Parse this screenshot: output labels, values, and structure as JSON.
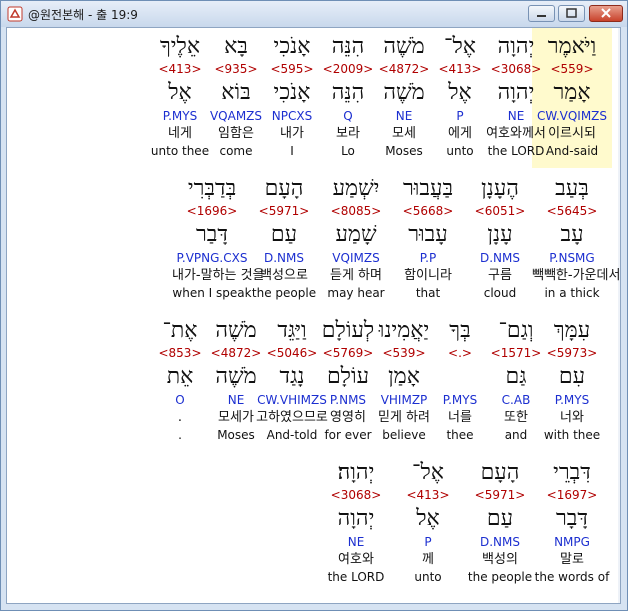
{
  "window": {
    "title": "@원전본해 - 출 19:9"
  },
  "verse": {
    "rows": [
      [
        {
          "heb1": "וַיֹּאמֶר",
          "strong": "<559>",
          "heb2": "אָמַר",
          "morph": "CW.VQIMZS",
          "kor": "이르시되",
          "eng": "And-said",
          "selected": true
        },
        {
          "heb1": "יְהוָה",
          "strong": "<3068>",
          "heb2": "יְהוָה",
          "morph": "NE",
          "kor": "여호와께서",
          "eng": "the LORD"
        },
        {
          "heb1": "אֶל־",
          "strong": "<413>",
          "heb2": "אֶל",
          "morph": "P",
          "kor": "에게",
          "eng": "unto"
        },
        {
          "heb1": "מֹשֶׁה",
          "strong": "<4872>",
          "heb2": "מֹשֶׁה",
          "morph": "NE",
          "kor": "모세",
          "eng": "Moses"
        },
        {
          "heb1": "הִנֵּה",
          "strong": "<2009>",
          "heb2": "הִנֵּה",
          "morph": "Q",
          "kor": "보라",
          "eng": "Lo"
        },
        {
          "heb1": "אָנֹכִי",
          "strong": "<595>",
          "heb2": "אָנֹכִי",
          "morph": "NPCXS",
          "kor": "내가",
          "eng": "I"
        },
        {
          "heb1": "בָּא",
          "strong": "<935>",
          "heb2": "בּוֹא",
          "morph": "VQAMZS",
          "kor": "임함은",
          "eng": "come"
        },
        {
          "heb1": "אֵלֶיךָ",
          "strong": "<413>",
          "heb2": "אֶל",
          "morph": "P.MYS",
          "kor": "네게",
          "eng": "unto thee"
        }
      ],
      [
        {
          "heb1": "בְּעַב",
          "strong": "<5645>",
          "heb2": "עָב",
          "morph": "P.NSMG",
          "kor": "빽빽한-가운데서",
          "eng": "in a thick"
        },
        {
          "heb1": "הֶעָנָן",
          "strong": "<6051>",
          "heb2": "עָנָן",
          "morph": "D.NMS",
          "kor": "구름",
          "eng": "cloud"
        },
        {
          "heb1": "בַּעֲבוּר",
          "strong": "<5668>",
          "heb2": "עָבוּר",
          "morph": "P.P",
          "kor": "함이니라",
          "eng": "that"
        },
        {
          "heb1": "יִשְׁמַע",
          "strong": "<8085>",
          "heb2": "שָׁמַע",
          "morph": "VQIMZS",
          "kor": "듣게 하며",
          "eng": "may hear"
        },
        {
          "heb1": "הָעָם",
          "strong": "<5971>",
          "heb2": "עַם",
          "morph": "D.NMS",
          "kor": "백성으로",
          "eng": "the people"
        },
        {
          "heb1": "בְּדַבְּרִי",
          "strong": "<1696>",
          "heb2": "דָּבַר",
          "morph": "P.VPNG.CXS",
          "kor": "내가-말하는 것을",
          "eng": "when I speak"
        }
      ],
      [
        {
          "heb1": "עִמָּךְ",
          "strong": "<5973>",
          "heb2": "עִם",
          "morph": "P.MYS",
          "kor": "너와",
          "eng": "with thee"
        },
        {
          "heb1": "וְגַם־",
          "strong": "<1571>",
          "heb2": "גַּם",
          "morph": "C.AB",
          "kor": "또한",
          "eng": "and"
        },
        {
          "heb1": "בְּךָ",
          "strong": "<.>",
          "heb2": "",
          "morph": "P.MYS",
          "kor": "너를",
          "eng": "thee"
        },
        {
          "heb1": "יַאֲמִינוּ",
          "strong": "<539>",
          "heb2": "אָמַן",
          "morph": "VHIMZP",
          "kor": "믿게 하려",
          "eng": "believe"
        },
        {
          "heb1": "לְעוֹלָם",
          "strong": "<5769>",
          "heb2": "עוֹלָם",
          "morph": "P.NMS",
          "kor": "영영히",
          "eng": "for ever"
        },
        {
          "heb1": "וַיַּגֵּד",
          "strong": "<5046>",
          "heb2": "נָגַד",
          "morph": "CW.VHIMZS",
          "kor": "고하였으므로",
          "eng": "And-told"
        },
        {
          "heb1": "מֹשֶׁה",
          "strong": "<4872>",
          "heb2": "מֹשֶׁה",
          "morph": "NE",
          "kor": "모세가",
          "eng": "Moses"
        },
        {
          "heb1": "אֶת־",
          "strong": "<853>",
          "heb2": "אֵת",
          "morph": "O",
          "kor": ".",
          "eng": "."
        }
      ],
      [
        {
          "heb1": "דִּבְרֵי",
          "strong": "<1697>",
          "heb2": "דָּבָר",
          "morph": "NMPG",
          "kor": "말로",
          "eng": "the words of"
        },
        {
          "heb1": "הָעָם",
          "strong": "<5971>",
          "heb2": "עַם",
          "morph": "D.NMS",
          "kor": "백성의",
          "eng": "the people"
        },
        {
          "heb1": "אֶל־",
          "strong": "<413>",
          "heb2": "אֶל",
          "morph": "P",
          "kor": "께",
          "eng": "unto"
        },
        {
          "heb1": "יְהוָה׃",
          "strong": "<3068>",
          "heb2": "יְהוָה",
          "morph": "NE",
          "kor": "여호와",
          "eng": "the LORD"
        }
      ]
    ]
  }
}
